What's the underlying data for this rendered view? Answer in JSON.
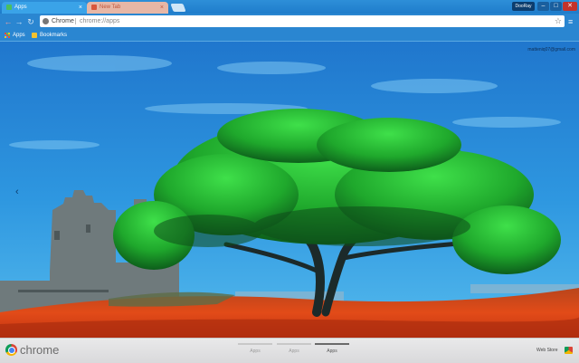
{
  "tabs": [
    {
      "label": "Apps",
      "favicon_color": "#4bbf5f"
    },
    {
      "label": "New Tab",
      "favicon_color": "#d9573c"
    }
  ],
  "window": {
    "profile_label": "DooRay",
    "minimize_icon": "minimize-icon",
    "maximize_icon": "maximize-icon",
    "close_icon": "close-icon"
  },
  "omnibox": {
    "scheme": "Chrome",
    "url": "chrome://apps"
  },
  "bookmarks_bar": {
    "items": [
      {
        "label": "Apps"
      },
      {
        "label": "Bookmarks"
      }
    ]
  },
  "user_email": "matteniq07@gmail.com",
  "footer": {
    "brand": "chrome",
    "page_tabs": [
      {
        "label": "Apps",
        "active": false
      },
      {
        "label": "Apps",
        "active": false
      },
      {
        "label": "Apps",
        "active": true
      }
    ],
    "webstore_label": "Web Store"
  },
  "colors": {
    "sky": "#1b6fc4",
    "grass": "#e04a1b",
    "tree": "#2fbf3a",
    "tabstrip": "#2e8fd8"
  }
}
